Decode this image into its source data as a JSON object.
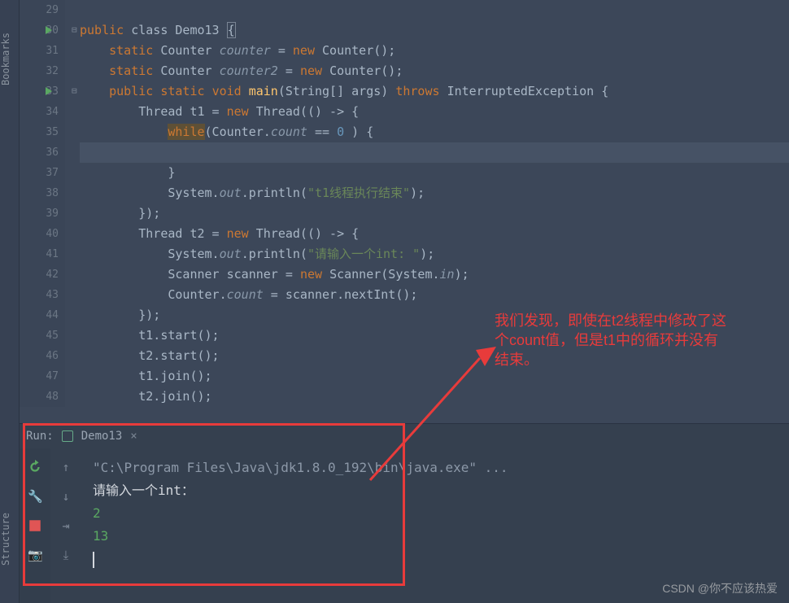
{
  "sidebar": {
    "labels": {
      "bookmarks": "Bookmarks",
      "structure": "Structure"
    }
  },
  "gutter": {
    "start": 29,
    "count": 20
  },
  "code": {
    "l30_a": "public",
    "l30_b": " class ",
    "l30_c": "Demo13 ",
    "l30_d": "{",
    "l31_a": "    static ",
    "l31_b": "Counter ",
    "l31_c": "counter",
    "l31_d": " = ",
    "l31_e": "new ",
    "l31_f": "Counter();",
    "l32_a": "    static ",
    "l32_b": "Counter ",
    "l32_c": "counter2",
    "l32_d": " = ",
    "l32_e": "new ",
    "l32_f": "Counter();",
    "l33_a": "    public static ",
    "l33_b": "void ",
    "l33_c": "main",
    "l33_d": "(String[] args) ",
    "l33_e": "throws ",
    "l33_f": "InterruptedException {",
    "l34_a": "        Thread t1 = ",
    "l34_b": "new ",
    "l34_c": "Thread(() -> {",
    "l35_a": "            ",
    "l35_b": "while",
    "l35_c": "(Counter.",
    "l35_d": "count",
    "l35_e": " == ",
    "l35_f": "0 ",
    "l35_g": ") {",
    "l36": " ",
    "l37": "            }",
    "l38_a": "            System.",
    "l38_b": "out",
    "l38_c": ".println(",
    "l38_d": "\"t1线程执行结束\"",
    "l38_e": ");",
    "l39": "        });",
    "l40_a": "        Thread t2 = ",
    "l40_b": "new ",
    "l40_c": "Thread(() -> {",
    "l41_a": "            System.",
    "l41_b": "out",
    "l41_c": ".println(",
    "l41_d": "\"请输入一个int: \"",
    "l41_e": ");",
    "l42_a": "            Scanner scanner = ",
    "l42_b": "new ",
    "l42_c": "Scanner(System.",
    "l42_d": "in",
    "l42_e": ");",
    "l43_a": "            Counter.",
    "l43_b": "count",
    "l43_c": " = scanner.nextInt();",
    "l44": "        });",
    "l45": "        t1.start();",
    "l46": "        t2.start();",
    "l47": "        t1.join();",
    "l48": "        t2.join();"
  },
  "run": {
    "label": "Run:",
    "tab": "Demo13",
    "output": {
      "line1": "\"C:\\Program Files\\Java\\jdk1.8.0_192\\bin\\java.exe\" ...",
      "line2": "请输入一个int：",
      "line3": "2",
      "line4": "13"
    }
  },
  "annotation": {
    "text1": "我们发现，即使在t2线程中修改了这",
    "text2": "个count值，但是t1中的循环并没有",
    "text3": "结束。"
  },
  "watermark": "CSDN @你不应该热爱"
}
